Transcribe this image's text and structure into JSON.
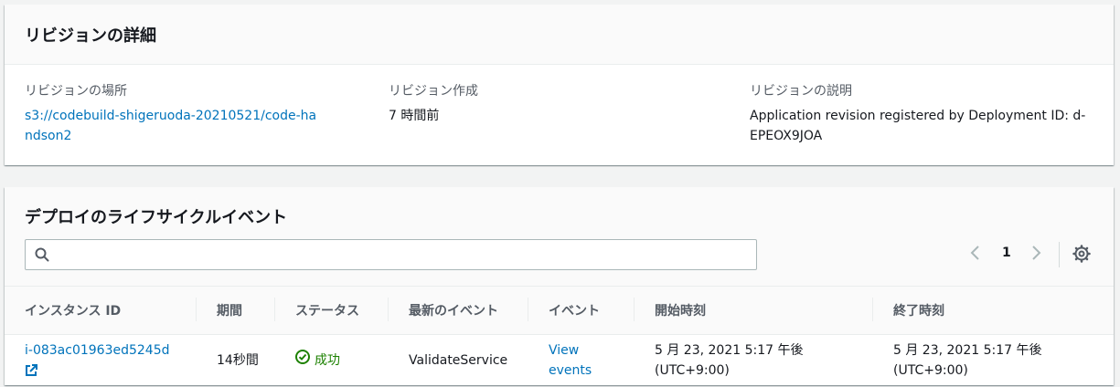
{
  "revision_panel": {
    "title": "リビジョンの詳細",
    "location_label": "リビジョンの場所",
    "location_value": "s3://codebuild-shigeruoda-20210521/code-handson2",
    "created_label": "リビジョン作成",
    "created_value": "7 時間前",
    "description_label": "リビジョンの説明",
    "description_value": "Application revision registered by Deployment ID: d-EPEOX9JOA"
  },
  "lifecycle_panel": {
    "title": "デプロイのライフサイクルイベント",
    "search_placeholder": "",
    "page_number": "1",
    "columns": [
      "インスタンス ID",
      "期間",
      "ステータス",
      "最新のイベント",
      "イベント",
      "開始時刻",
      "終了時刻"
    ],
    "rows": [
      {
        "instance_id": "i-083ac01963ed5245d",
        "duration": "14秒間",
        "status": "成功",
        "latest_event": "ValidateService",
        "events_link": "View events",
        "start_time": "5 月 23, 2021 5:17 午後 (UTC+9:00)",
        "end_time": "5 月 23, 2021 5:17 午後 (UTC+9:00)"
      }
    ]
  },
  "colors": {
    "link": "#0073bb",
    "success": "#1d8102",
    "label": "#545b64"
  }
}
